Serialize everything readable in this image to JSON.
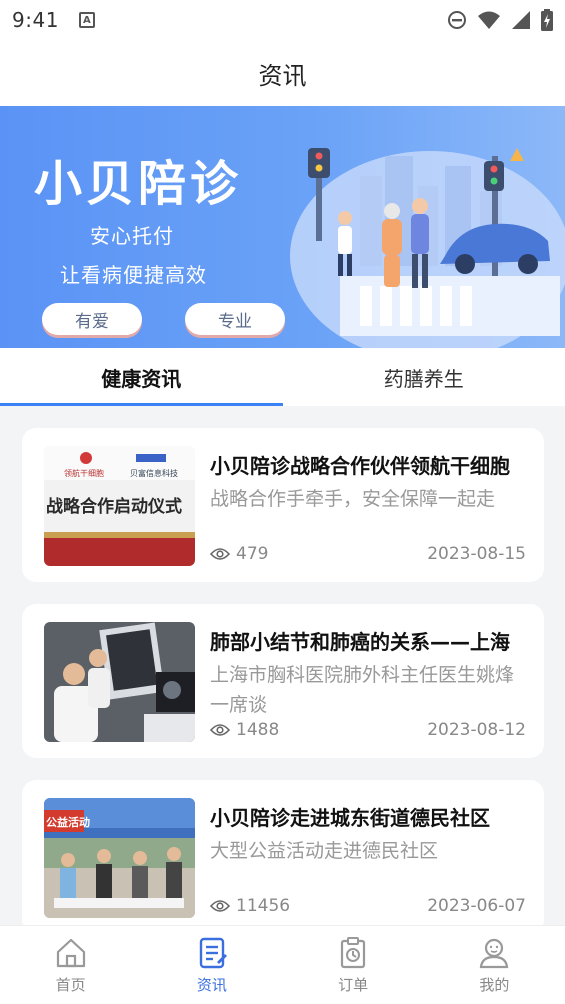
{
  "status": {
    "time": "9:41"
  },
  "header": {
    "title": "资讯"
  },
  "banner": {
    "title": "小贝陪诊",
    "subtitle1": "安心托付",
    "subtitle2": "让看病便捷高效",
    "pill1": "有爱",
    "pill2": "专业"
  },
  "tabs": [
    {
      "label": "健康资讯",
      "active": true
    },
    {
      "label": "药膳养生",
      "active": false
    }
  ],
  "articles": [
    {
      "title": "小贝陪诊战略合作伙伴领航干细胞",
      "desc": "战略合作手牵手，安全保障一起走",
      "views": "479",
      "date": "2023-08-15",
      "img_text1": "领航干细胞",
      "img_text2": "贝富信息科技",
      "img_text3": "战略合作启动仪式"
    },
    {
      "title": "肺部小结节和肺癌的关系——上海",
      "desc": "上海市胸科医院肺外科主任医生姚烽一席谈",
      "views": "1488",
      "date": "2023-08-12"
    },
    {
      "title": "小贝陪诊走进城东街道德民社区",
      "desc": "大型公益活动走进德民社区",
      "views": "11456",
      "date": "2023-06-07",
      "img_text1": "公益活动"
    }
  ],
  "nav": [
    {
      "label": "首页",
      "icon": "home-icon",
      "active": false
    },
    {
      "label": "资讯",
      "icon": "news-icon",
      "active": true
    },
    {
      "label": "订单",
      "icon": "order-icon",
      "active": false
    },
    {
      "label": "我的",
      "icon": "profile-icon",
      "active": false
    }
  ],
  "colors": {
    "accent": "#3b82f6",
    "banner": "#5a93f5"
  }
}
